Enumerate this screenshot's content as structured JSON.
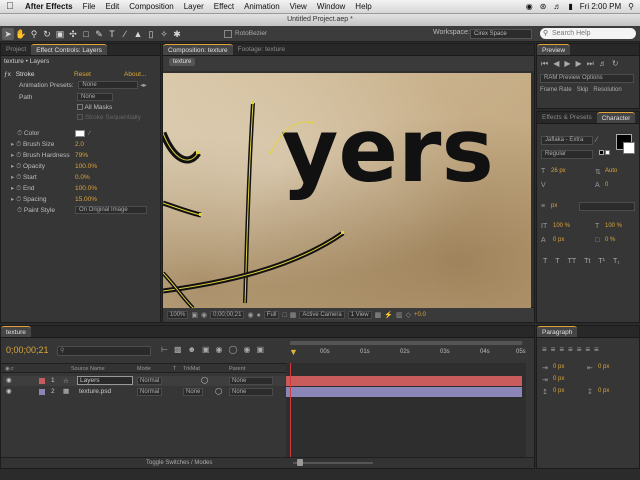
{
  "menubar": {
    "apple": "",
    "app": "After Effects",
    "items": [
      "File",
      "Edit",
      "Composition",
      "Layer",
      "Effect",
      "Animation",
      "View",
      "Window",
      "Help"
    ],
    "clock": "Fri 2:00 PM"
  },
  "titlebar": {
    "title": "Untitled Project.aep *"
  },
  "toolbar": {
    "tools": [
      "selection-tool",
      "hand-tool",
      "zoom-tool",
      "rotation-tool",
      "camera-tool",
      "pan-behind-tool",
      "rectangle-tool",
      "pen-tool",
      "type-tool",
      "brush-tool",
      "clone-stamp-tool",
      "eraser-tool",
      "roto-brush-tool",
      "puppet-tool"
    ],
    "roto_bezier": "RotoBezier",
    "workspace_label": "Workspace:",
    "workspace_value": "Cirex Space",
    "search_placeholder": "Search Help"
  },
  "effect_controls": {
    "tabs": [
      "Project",
      "Effect Controls: Layers"
    ],
    "breadcrumb": "texture • Layers",
    "effect_name": "Stroke",
    "reset": "Reset",
    "about": "About...",
    "animation_presets_label": "Animation Presets:",
    "animation_presets_value": "None",
    "path_label": "Path",
    "path_value": "None",
    "all_masks": "All Masks",
    "stroke_sequentially": "Stroke Sequentially",
    "properties": [
      {
        "label": "Color",
        "value": ""
      },
      {
        "label": "Brush Size",
        "value": "2.0"
      },
      {
        "label": "Brush Hardness",
        "value": "79%"
      },
      {
        "label": "Opacity",
        "value": "100.0%"
      },
      {
        "label": "Start",
        "value": "0.0%"
      },
      {
        "label": "End",
        "value": "100.0%"
      },
      {
        "label": "Spacing",
        "value": "15.00%"
      },
      {
        "label": "Paint Style",
        "value": "On Original Image"
      }
    ]
  },
  "composition": {
    "tabs": [
      "Composition: texture",
      "Footage: texture"
    ],
    "subtab": "texture",
    "zoom": "100%",
    "timecode": "0;00;00;21",
    "resolution": "Full",
    "camera": "Active Camera",
    "views": "1 View",
    "exposure": "+0.0",
    "canvas_text": "yers"
  },
  "right_panels": {
    "preview_tab": "Preview",
    "ram_preview": "RAM Preview Options",
    "frame_rate": "Frame Rate",
    "skip": "Skip",
    "resolution": "Resolution",
    "char_tabs": [
      "Effects & Presets",
      "Character"
    ],
    "font_name": "Jaflaka - Extra",
    "font_style": "Regular",
    "size_value": "26 px",
    "leading_value": "Auto",
    "tracking_value": "0",
    "unit_value": "px",
    "vscale_value": "100 %",
    "hscale_value": "100 %",
    "baseline_value": "0 px",
    "tsume_value": "0 %",
    "paragraph_tab": "Paragraph",
    "indent_values": [
      "0 px",
      "0 px",
      "0 px",
      "0 px",
      "0 px"
    ]
  },
  "timeline": {
    "tab": "texture",
    "timecode": "0;00;00;21",
    "columns": [
      "Source Name",
      "Mode",
      "T",
      "TrkMat",
      "Parent"
    ],
    "ruler": [
      "00s",
      "01s",
      "02s",
      "03s",
      "04s",
      "05s"
    ],
    "layers": [
      {
        "index": "1",
        "name": "Layers",
        "mode": "Normal",
        "trkmat": "",
        "parent": "None",
        "color": "#c85c5c"
      },
      {
        "index": "2",
        "name": "texture.psd",
        "mode": "Normal",
        "trkmat": "None",
        "parent": "None",
        "color": "#8a86b8"
      }
    ],
    "toggle_label": "Toggle Switches / Modes"
  }
}
